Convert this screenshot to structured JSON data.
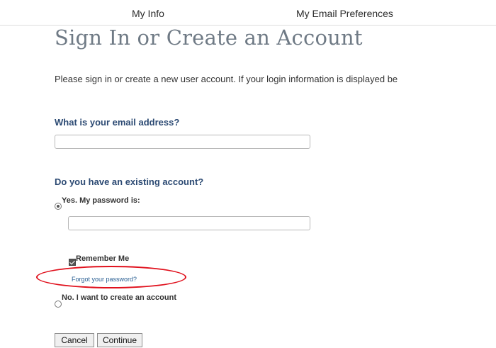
{
  "nav": {
    "my_info": "My Info",
    "my_email_preferences": "My Email Preferences"
  },
  "page": {
    "title": "Sign In or Create an Account",
    "intro": "Please sign in or create a new user account. If your login information is displayed be"
  },
  "email_section": {
    "question": "What is your email address?",
    "value": ""
  },
  "account_section": {
    "question": "Do you have an existing account?",
    "yes_label": "Yes. My password is:",
    "yes_selected": true,
    "password_value": "",
    "remember_label": "Remember Me",
    "remember_checked": true,
    "forgot_link": "Forgot your password?",
    "no_label": "No. I want to create an account",
    "no_selected": false
  },
  "buttons": {
    "cancel": "Cancel",
    "continue": "Continue"
  },
  "colors": {
    "question_heading": "#2c4a73",
    "title_gray": "#6f7a85",
    "link_blue": "#2a5f93",
    "highlight_red": "#e0101c"
  }
}
